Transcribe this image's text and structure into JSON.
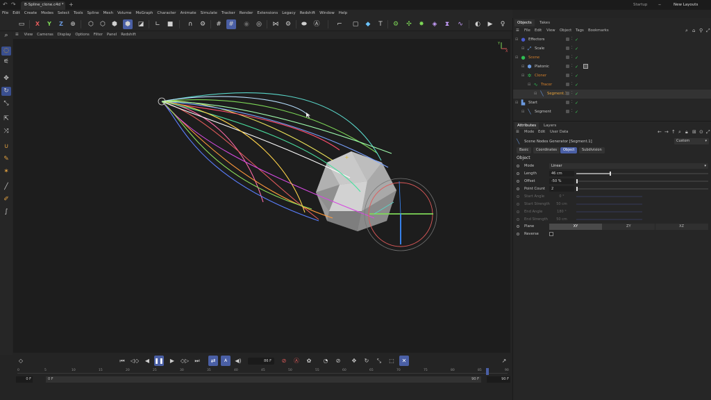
{
  "titlebar": {
    "file_tab": "B-Spline_clone.c4d *",
    "startup_label": "Startup",
    "layout_label": "New Layouts"
  },
  "menubar": [
    "File",
    "Edit",
    "Create",
    "Modes",
    "Select",
    "Tools",
    "Spline",
    "Mesh",
    "Volume",
    "MoGraph",
    "Character",
    "Animate",
    "Simulate",
    "Tracker",
    "Render",
    "Extensions",
    "Legacy",
    "Redshift",
    "Window",
    "Help"
  ],
  "toolbar": {
    "axis_x": "X",
    "axis_y": "Y",
    "axis_z": "Z"
  },
  "viewport_menu": [
    "View",
    "Cameras",
    "Display",
    "Options",
    "Filter",
    "Panel",
    "Redshift"
  ],
  "viewport": {
    "axis_label_x": "X",
    "axis_label_y": "Y"
  },
  "timeline": {
    "current_frame": "86 F",
    "ticks": [
      "0",
      "5",
      "10",
      "15",
      "20",
      "25",
      "30",
      "35",
      "40",
      "45",
      "50",
      "55",
      "60",
      "65",
      "70",
      "75",
      "80",
      "85",
      "90"
    ],
    "range_start": "0 F",
    "range_start2": "0 F",
    "range_end": "90 F",
    "range_end2": "90 F"
  },
  "objects_panel": {
    "tabs": [
      "Objects",
      "Takes"
    ],
    "menu": [
      "File",
      "Edit",
      "View",
      "Object",
      "Tags",
      "Bookmarks"
    ],
    "rows": [
      {
        "name": "Effectors",
        "color": "#c8c8c8",
        "indent": 0,
        "icon": "●",
        "icon_color": "#4a5ad0"
      },
      {
        "name": "Scale",
        "color": "#c8c8c8",
        "indent": 1,
        "icon": "⤢",
        "icon_color": "#6b9ae0"
      },
      {
        "name": "Scene",
        "color": "#d9822b",
        "indent": 0,
        "icon": "●",
        "icon_color": "#2fbd52"
      },
      {
        "name": "Platonic",
        "color": "#c8c8c8",
        "indent": 1,
        "icon": "⬢",
        "icon_color": "#6b9ae0"
      },
      {
        "name": "Cloner",
        "color": "#d9822b",
        "indent": 1,
        "icon": "✲",
        "icon_color": "#2fbd52"
      },
      {
        "name": "Tracer",
        "color": "#d9822b",
        "indent": 2,
        "icon": "∿",
        "icon_color": "#2fbd52"
      },
      {
        "name": "Segment.1",
        "color": "#f0a83a",
        "indent": 3,
        "icon": "╲",
        "icon_color": "#6b9ae0"
      },
      {
        "name": "Start",
        "color": "#c8c8c8",
        "indent": 0,
        "icon": "▙",
        "icon_color": "#6b9ae0"
      },
      {
        "name": "Segment",
        "color": "#c8c8c8",
        "indent": 1,
        "icon": "╲",
        "icon_color": "#6b9ae0"
      }
    ]
  },
  "attributes_panel": {
    "tabs": [
      "Attributes",
      "Layers"
    ],
    "menu": [
      "Mode",
      "Edit",
      "User Data"
    ],
    "node_title": "Scene Nodes Generator [Segment.1]",
    "preset": "Custom",
    "sub_tabs": [
      "Basic",
      "Coordinates",
      "Object",
      "Subdivision"
    ],
    "section": "Object",
    "fields": [
      {
        "label": "Mode",
        "value": "Linear",
        "type": "dropdown",
        "enabled": true
      },
      {
        "label": "Length",
        "value": "46 cm",
        "type": "slider",
        "fill": 0.25,
        "enabled": true
      },
      {
        "label": "Offset",
        "value": "-50 %",
        "type": "slider",
        "fill": 0.0,
        "enabled": true
      },
      {
        "label": "Point Count",
        "value": "2",
        "type": "slider",
        "fill": 0.0,
        "enabled": true
      },
      {
        "label": "Start Angle",
        "value": "0 °",
        "type": "slider",
        "fill": 0.0,
        "enabled": false
      },
      {
        "label": "Start Strength",
        "value": "50 cm",
        "type": "slider",
        "fill": 0.0,
        "enabled": false
      },
      {
        "label": "End Angle",
        "value": "180 °",
        "type": "slider",
        "fill": 0.0,
        "enabled": false
      },
      {
        "label": "End Strength",
        "value": "50 cm",
        "type": "slider",
        "fill": 0.0,
        "enabled": false
      }
    ],
    "plane_label": "Plane",
    "plane_options": [
      "XY",
      "ZY",
      "XZ"
    ],
    "plane_selected": "XY",
    "reverse_label": "Reverse",
    "reverse_checked": false
  }
}
